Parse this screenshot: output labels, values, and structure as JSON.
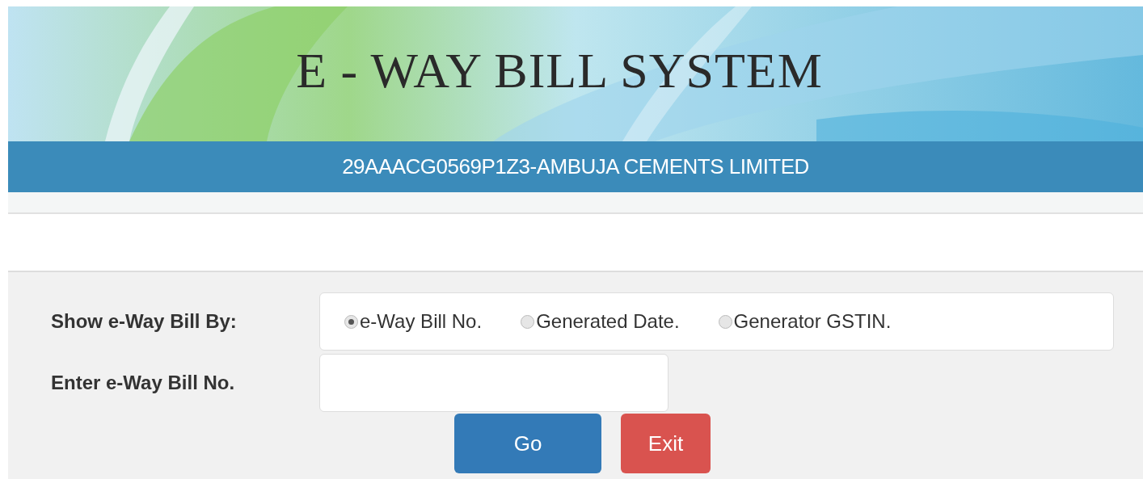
{
  "header": {
    "title": "E - WAY BILL SYSTEM",
    "subtitle": "29AAACG0569P1Z3-AMBUJA CEMENTS LIMITED"
  },
  "form": {
    "show_by_label": "Show e-Way Bill By:",
    "options": [
      {
        "label": "e-Way Bill No.",
        "selected": true
      },
      {
        "label": "Generated Date.",
        "selected": false
      },
      {
        "label": "Generator GSTIN.",
        "selected": false
      }
    ],
    "entry_label": "Enter e-Way Bill No.",
    "buttons": [
      {
        "label": "Go",
        "kind": "primary"
      },
      {
        "label": "Exit",
        "kind": "danger"
      }
    ]
  }
}
